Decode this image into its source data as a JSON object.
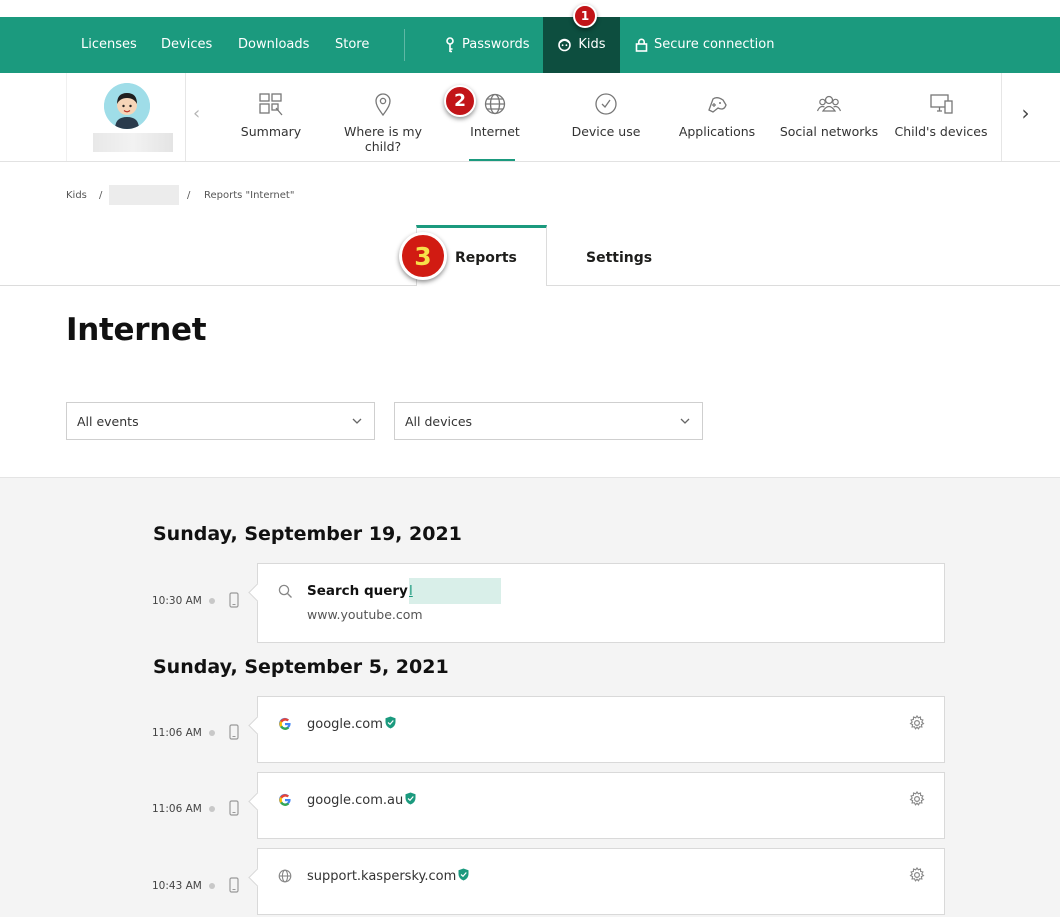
{
  "topnav": {
    "items": [
      "Licenses",
      "Devices",
      "Downloads",
      "Store"
    ],
    "passwords": "Passwords",
    "kids": "Kids",
    "secure": "Secure connection"
  },
  "annotations": [
    "1",
    "2",
    "3"
  ],
  "subnav": {
    "items": [
      "Summary",
      "Where is my child?",
      "Internet",
      "Device use",
      "Applications",
      "Social networks",
      "Child's devices"
    ],
    "active": "Internet"
  },
  "breadcrumb": {
    "root": "Kids",
    "separator": "/",
    "current": "Reports \"Internet\""
  },
  "tabs": [
    "Reports",
    "Settings"
  ],
  "page_title": "Internet",
  "filters": {
    "events": "All events",
    "devices": "All devices"
  },
  "days": [
    {
      "date": "Sunday, September 19, 2021",
      "entries": [
        {
          "time": "10:30 AM",
          "type": "search",
          "label": "Search query:",
          "query": "l",
          "url": "www.youtube.com"
        }
      ]
    },
    {
      "date": "Sunday, September 5, 2021",
      "entries": [
        {
          "time": "11:06 AM",
          "type": "site",
          "site": "google.com",
          "icon": "google-icon"
        },
        {
          "time": "11:06 AM",
          "type": "site",
          "site": "google.com.au",
          "icon": "google-icon"
        },
        {
          "time": "10:43 AM",
          "type": "site",
          "site": "support.kaspersky.com",
          "icon": "globe-icon"
        }
      ]
    }
  ],
  "colors": {
    "brand": "#1b9a7e",
    "brand_dark": "#0d4e3f",
    "badge": "#c21418"
  }
}
